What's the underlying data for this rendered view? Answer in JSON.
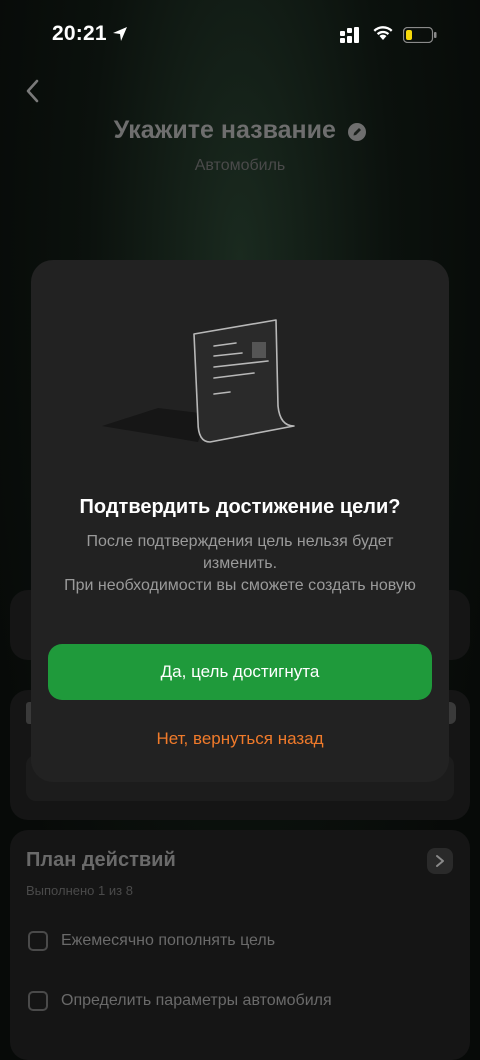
{
  "status_bar": {
    "time": "20:21",
    "icons": [
      "location-arrow-icon",
      "cellular-signal-icon",
      "wifi-icon",
      "battery-low-icon"
    ]
  },
  "header": {
    "title": "Укажите название",
    "subtitle": "Автомобиль"
  },
  "plan": {
    "title": "План действий",
    "progress": "Выполнено 1 из 8",
    "tasks": [
      {
        "label": "Ежемесячно пополнять цель",
        "checked": false
      },
      {
        "label": "Определить параметры автомобиля",
        "checked": false
      }
    ]
  },
  "modal": {
    "illustration": "document-icon",
    "title": "Подтвердить достижение цели?",
    "body_line1": "После подтверждения цель нельзя будет изменить.",
    "body_line2": "При необходимости вы сможете создать новую",
    "confirm_label": "Да, цель достигнута",
    "cancel_label": "Нет, вернуться назад"
  },
  "colors": {
    "accent_green": "#1f9a3b",
    "cancel_orange": "#f07a2a",
    "modal_bg": "#222222"
  }
}
